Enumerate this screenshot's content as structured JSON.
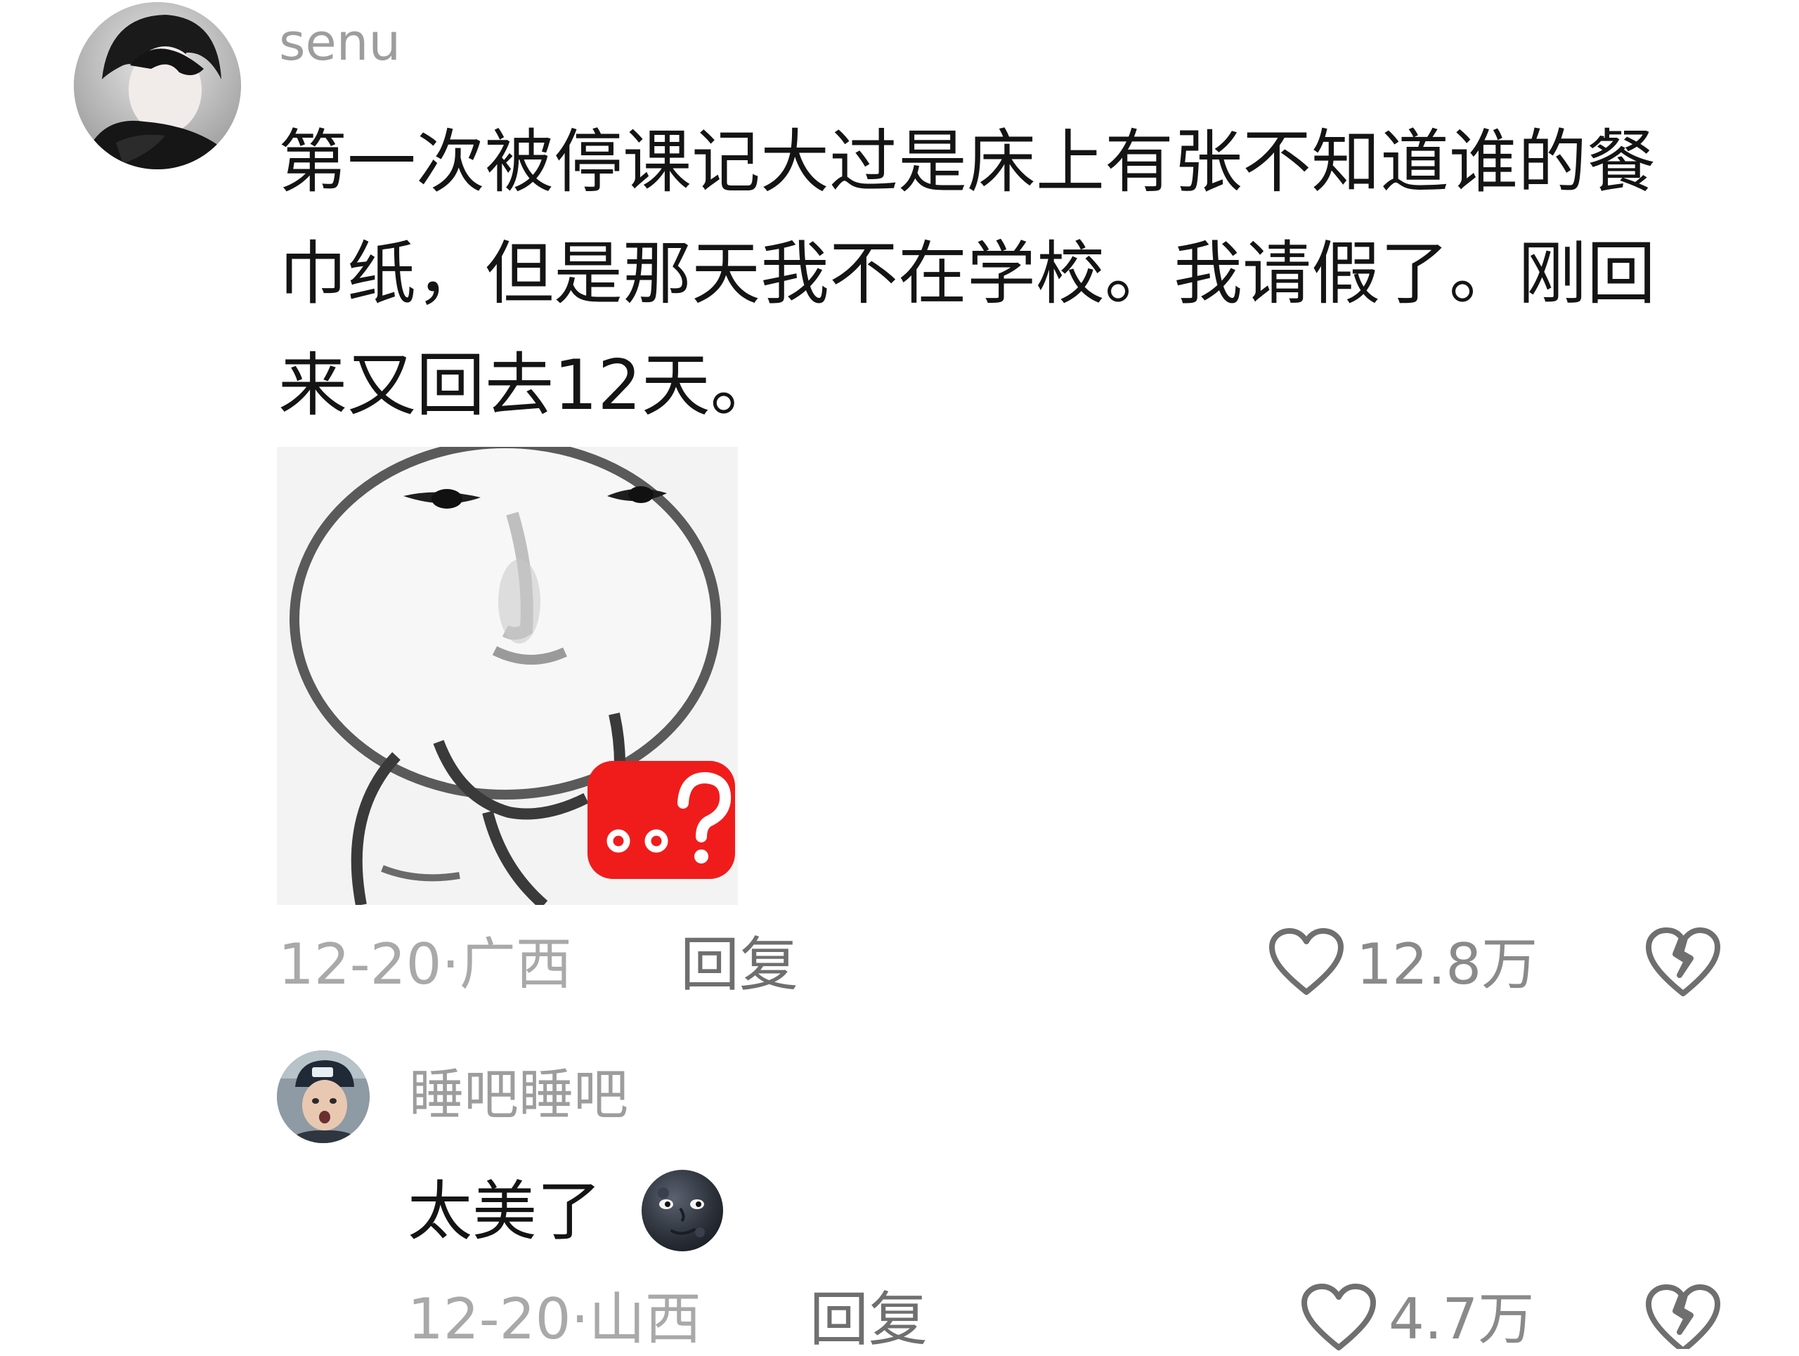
{
  "comments": [
    {
      "username": "senu",
      "text_lines": [
        "第一次被停课记大过是床上有张不知道谁的餐",
        "巾纸，但是那天我不在学校。我请假了。刚回",
        "来又回去12天。"
      ],
      "sticker": {
        "badge_text": "..?",
        "badge_color": "#f01c1c"
      },
      "date": "12-20",
      "location": "广西",
      "reply_label": "回复",
      "like_count": "12.8万",
      "icons": [
        "heart-icon",
        "broken-heart-icon"
      ]
    },
    {
      "username": "睡吧睡吧",
      "text": "太美了",
      "emoji": "new-moon-face-emoji",
      "date": "12-20",
      "location": "山西",
      "reply_label": "回复",
      "like_count": "4.7万",
      "icons": [
        "heart-icon",
        "broken-heart-icon"
      ]
    }
  ],
  "colors": {
    "text": "#141414",
    "meta": "#a9a9a9",
    "username": "#9d9d9d",
    "icon": "#6f6f6f"
  }
}
